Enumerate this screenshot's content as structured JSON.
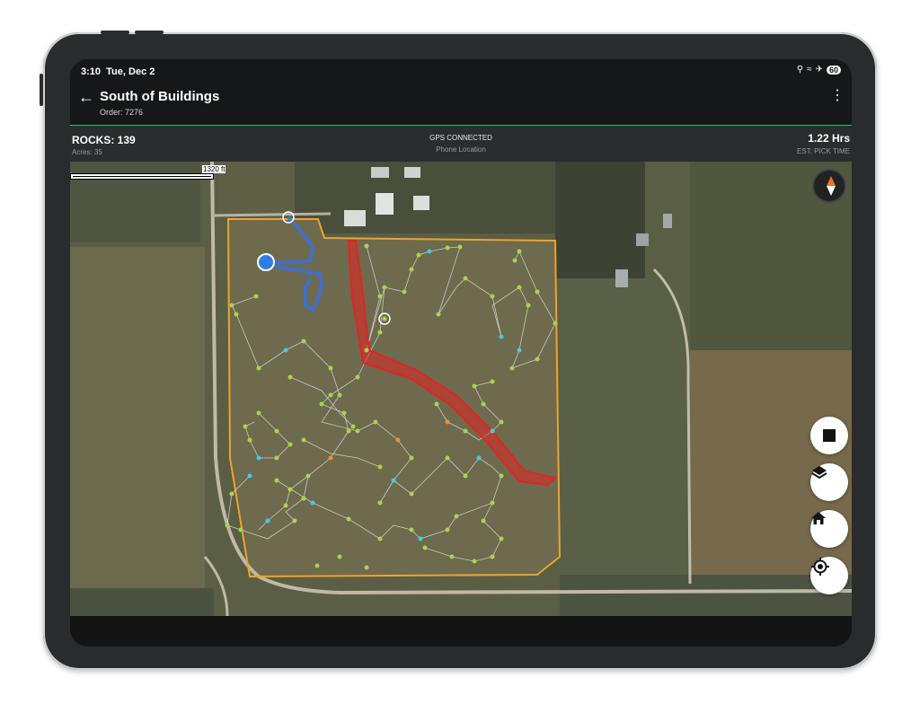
{
  "status_bar": {
    "time": "3:10",
    "date": "Tue, Dec 2",
    "battery": "60"
  },
  "app_bar": {
    "title": "South of Buildings",
    "subtitle": "Order: 7276"
  },
  "stats": {
    "rocks": "ROCKS: 139",
    "acres": "Acres: 35",
    "gps_status": "GPS CONNECTED",
    "location_source": "Phone Location",
    "pick_time": "1.22 Hrs",
    "pick_time_label": "EST. PICK TIME"
  },
  "map": {
    "scale_label": "1320 ft",
    "colors": {
      "boundary": "#f0a22b",
      "rock_green": "#a7d64a",
      "rock_cyan": "#46c9e6",
      "rock_orange": "#f0902a",
      "route_line": "#d9d9d9",
      "walked_path": "#3b6fe0",
      "exclusion_zone": "#e22424",
      "user_position": "#2f7de1"
    }
  },
  "controls": {
    "stop": "stop-icon",
    "layers": "layers-icon",
    "home": "home-icon",
    "locate": "my-location-icon",
    "compass": "compass-icon"
  }
}
